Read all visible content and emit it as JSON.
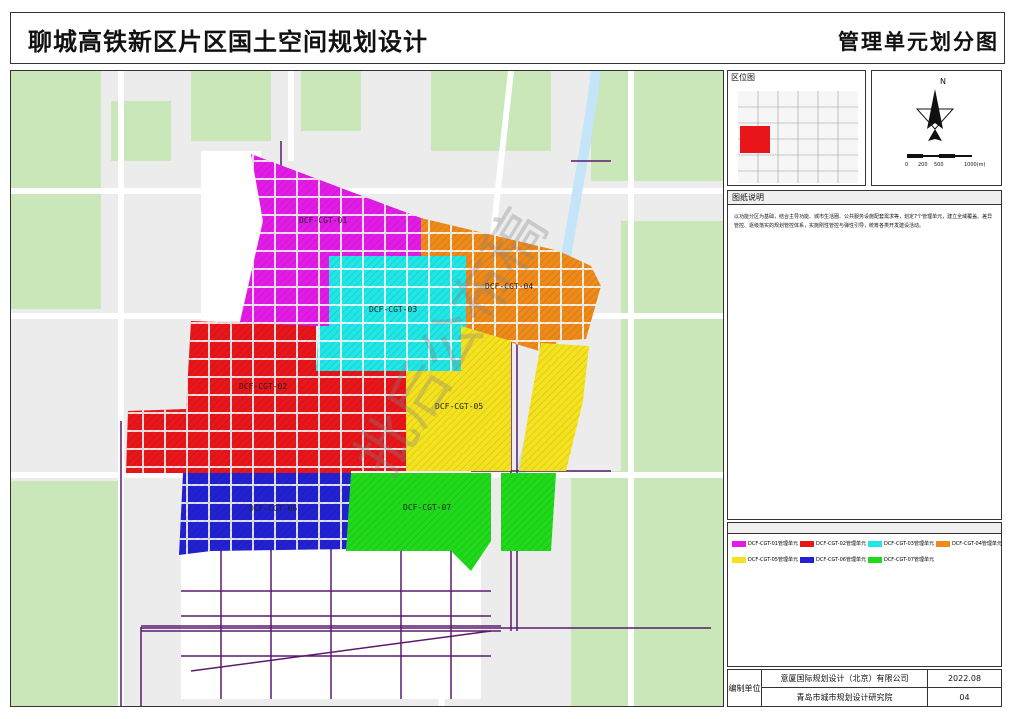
{
  "header": {
    "title": "聊城高铁新区片区国土空间规划设计",
    "subtitle": "管理单元划分图"
  },
  "map": {
    "units": [
      {
        "id": "DCF-CGT-01",
        "color": "#e21ce6"
      },
      {
        "id": "DCF-CGT-02",
        "color": "#e8161a"
      },
      {
        "id": "DCF-CGT-03",
        "color": "#21e6e6"
      },
      {
        "id": "DCF-CGT-04",
        "color": "#ee8a1a"
      },
      {
        "id": "DCF-CGT-05",
        "color": "#f5e21f"
      },
      {
        "id": "DCF-CGT-06",
        "color": "#2222d2"
      },
      {
        "id": "DCF-CGT-07",
        "color": "#20d91b"
      }
    ],
    "watermark": "批后公布稿"
  },
  "inset": {
    "location_label": "区位图",
    "north": "N",
    "scale_labels": [
      "0",
      "200",
      "500",
      "1000(m)"
    ]
  },
  "notes": {
    "header": "图纸说明",
    "text": "以功能分区为基础，结合主导功能、城市生活圈、公共服务设施配套需求等，划定7个管理单元，建立全域覆盖、差异管控、逐级落实的规划管控体系，实施刚性管控与弹性引导，统筹各类开发建设活动。"
  },
  "legend": [
    {
      "label": "DCF-CGT-01管理单元",
      "color": "#e21ce6"
    },
    {
      "label": "DCF-CGT-02管理单元",
      "color": "#e8161a"
    },
    {
      "label": "DCF-CGT-03管理单元",
      "color": "#21e6e6"
    },
    {
      "label": "DCF-CGT-04管理单元",
      "color": "#ee8a1a"
    },
    {
      "label": "DCF-CGT-05管理单元",
      "color": "#f5e21f"
    },
    {
      "label": "DCF-CGT-06管理单元",
      "color": "#2222d2"
    },
    {
      "label": "DCF-CGT-07管理单元",
      "color": "#20d91b"
    }
  ],
  "footer": {
    "unit_label": "编制单位",
    "org1": "意厦国际规划设计（北京）有限公司",
    "org2": "青岛市城市规划设计研究院",
    "date": "2022.08",
    "page": "04"
  }
}
